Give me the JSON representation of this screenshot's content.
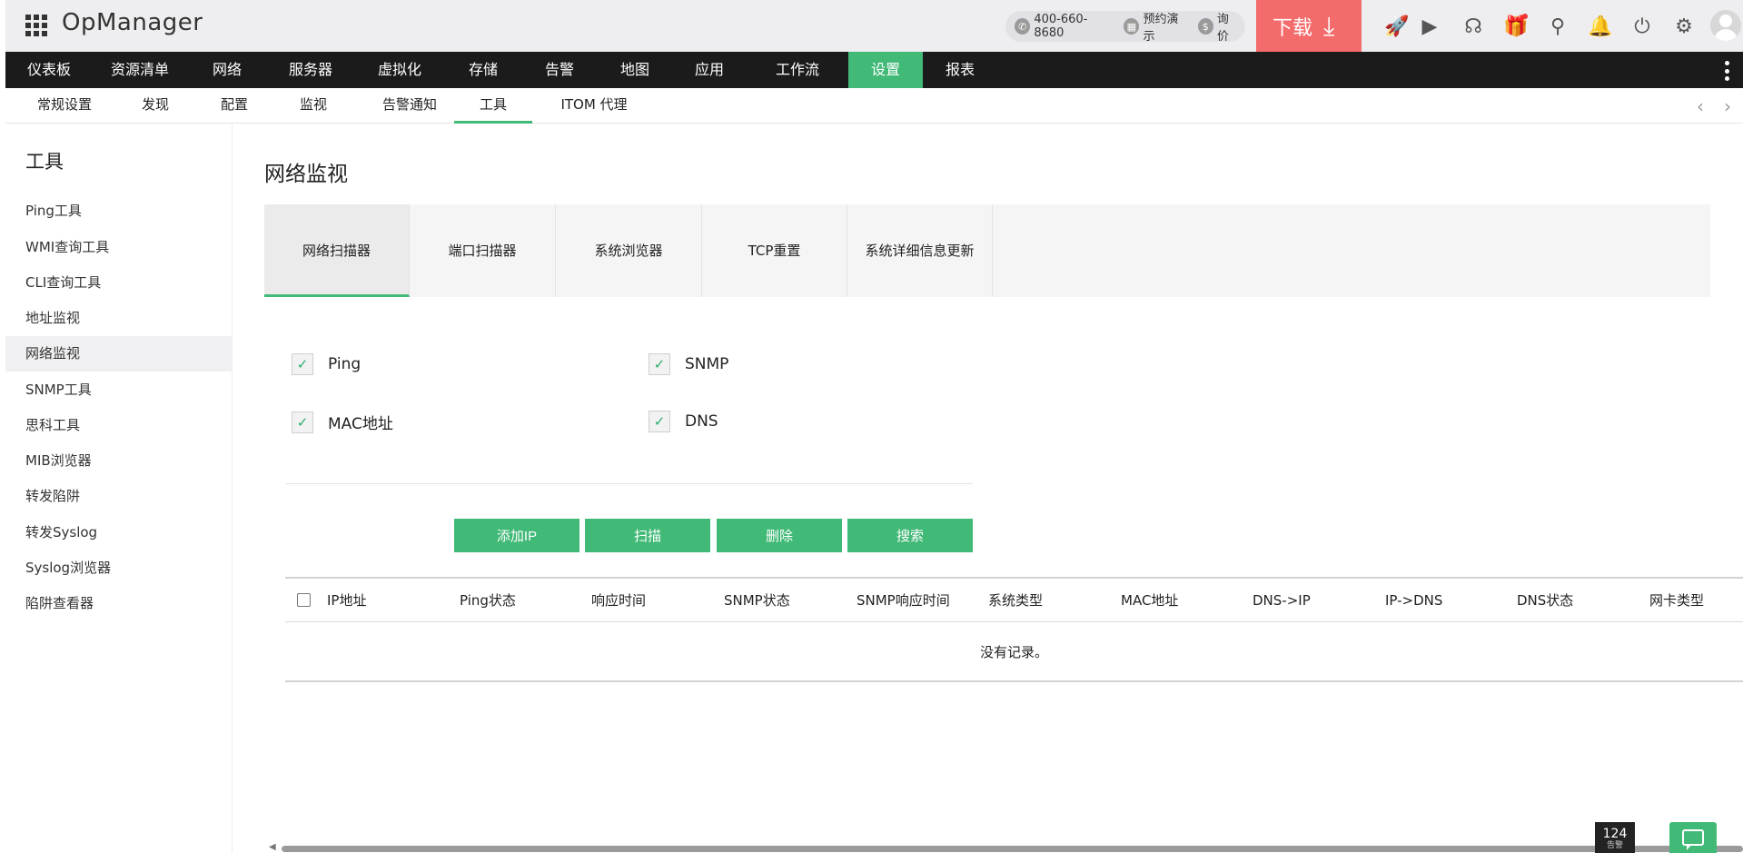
{
  "app": {
    "name": "OpManager"
  },
  "header": {
    "phone": "400-660-8680",
    "demo": "预约演示",
    "price": "询价",
    "download": "下载",
    "icons": [
      "rocket-icon",
      "presentation-icon",
      "headset-icon",
      "gift-icon",
      "search-icon",
      "bell-icon",
      "plug-icon",
      "gear-icon",
      "user-avatar"
    ]
  },
  "main_nav": [
    "仪表板",
    "资源清单",
    "网络",
    "服务器",
    "虚拟化",
    "存储",
    "告警",
    "地图",
    "应用",
    "工作流",
    "设置",
    "报表"
  ],
  "main_nav_active": "设置",
  "sub_nav": [
    "常规设置",
    "发现",
    "配置",
    "监视",
    "告警通知",
    "工具",
    "ITOM 代理"
  ],
  "sub_nav_active": "工具",
  "sidebar": {
    "title": "工具",
    "items": [
      "Ping工具",
      "WMI查询工具",
      "CLI查询工具",
      "地址监视",
      "网络监视",
      "SNMP工具",
      "思科工具",
      "MIB浏览器",
      "转发陷阱",
      "转发Syslog",
      "Syslog浏览器",
      "陷阱查看器"
    ],
    "active": "网络监视"
  },
  "page": {
    "title": "网络监视",
    "tabs": [
      "网络扫描器",
      "端口扫描器",
      "系统浏览器",
      "TCP重置",
      "系统详细信息更新"
    ],
    "active_tab": "网络扫描器",
    "checks": [
      {
        "label": "Ping",
        "checked": true
      },
      {
        "label": "SNMP",
        "checked": true
      },
      {
        "label": "MAC地址",
        "checked": true
      },
      {
        "label": "DNS",
        "checked": true
      }
    ],
    "buttons": [
      "添加IP",
      "扫描",
      "删除",
      "搜索"
    ],
    "table": {
      "columns": [
        "IP地址",
        "Ping状态",
        "响应时间",
        "SNMP状态",
        "SNMP响应时间",
        "系统类型",
        "MAC地址",
        "DNS->IP",
        "IP->DNS",
        "DNS状态",
        "网卡类型"
      ],
      "empty_text": "没有记录。"
    }
  },
  "footer": {
    "alarm_count": "124",
    "alarm_label": "告警"
  },
  "colors": {
    "accent": "#41b977",
    "download": "#f46b6b",
    "nav_bg": "#1b1b1b"
  }
}
